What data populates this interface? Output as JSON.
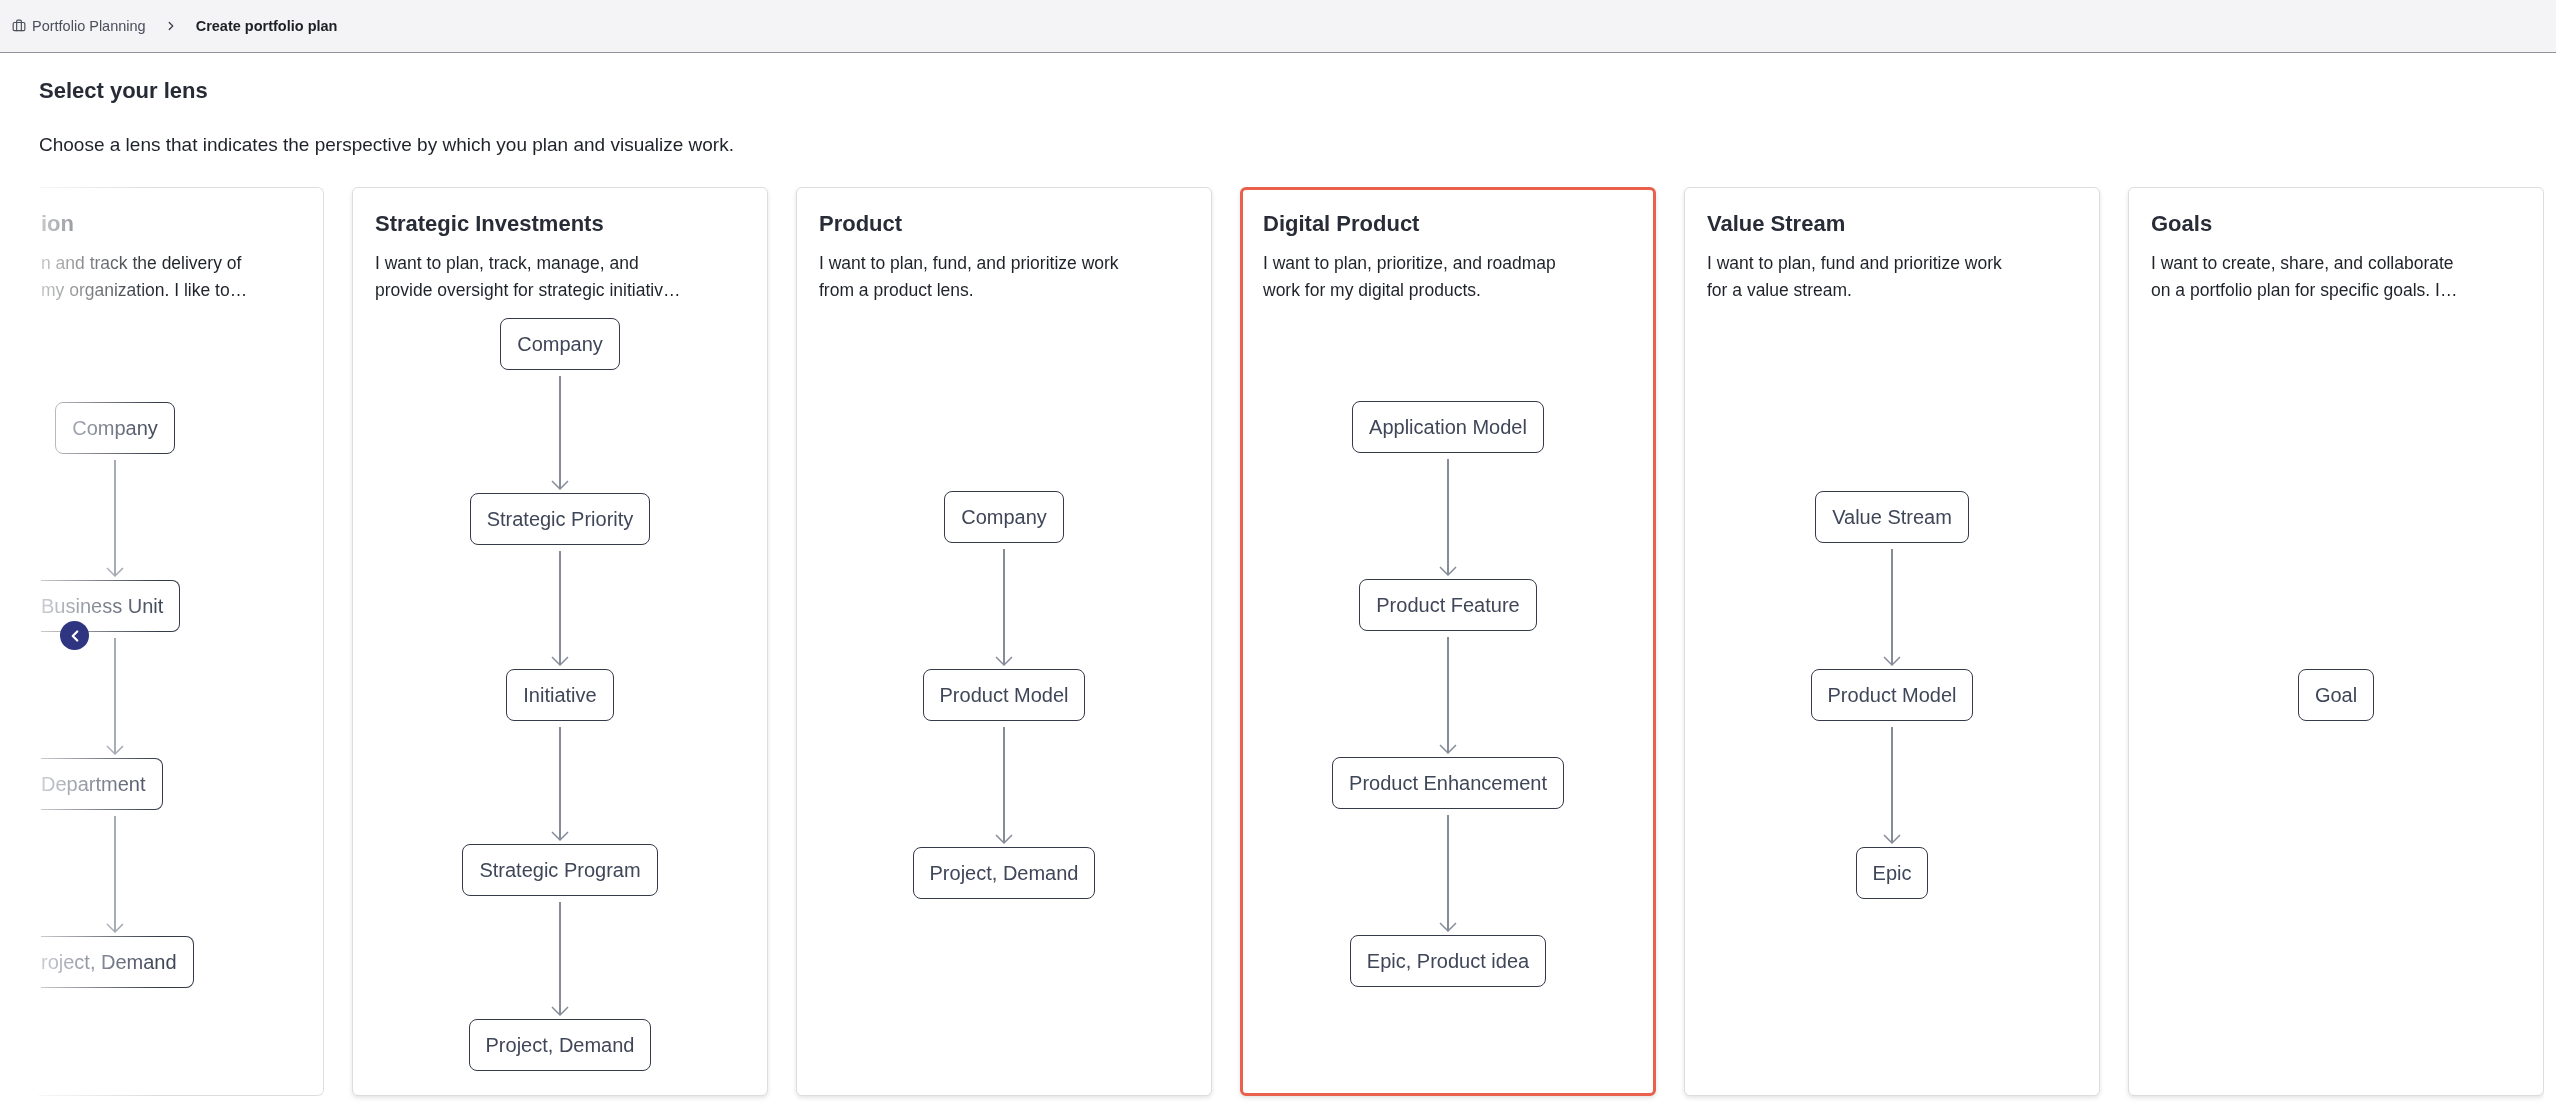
{
  "breadcrumb": [
    {
      "kind": "link",
      "label": "Portfolio Planning"
    },
    {
      "kind": "current",
      "label": "Create portfolio plan"
    }
  ],
  "page": {
    "title": "Select your lens",
    "description": "Choose a lens that indicates the perspective by which you plan and visualize work."
  },
  "lens_cards": [
    {
      "kind": "partial",
      "selected": false,
      "title": "ion",
      "description": [
        "n and track the delivery of",
        "my organization. I like to…"
      ],
      "nodes": [
        {
          "label": "Company",
          "clipped": false
        },
        {
          "label": "Business Unit",
          "clipped": true
        },
        {
          "label": "Department",
          "clipped": true
        },
        {
          "label": "roject, Demand",
          "clipped": true
        }
      ]
    },
    {
      "kind": "full",
      "selected": false,
      "title": "Strategic Investments",
      "description": [
        "I want to plan, track, manage, and",
        "provide oversight for strategic initiativ…"
      ],
      "nodes": [
        {
          "label": "Company",
          "clipped": false
        },
        {
          "label": "Strategic Priority",
          "clipped": false
        },
        {
          "label": "Initiative",
          "clipped": false
        },
        {
          "label": "Strategic Program",
          "clipped": false
        },
        {
          "label": "Project, Demand",
          "clipped": false
        }
      ]
    },
    {
      "kind": "full",
      "selected": false,
      "title": "Product",
      "description": [
        "I want to plan, fund, and prioritize work",
        "from a product lens."
      ],
      "nodes": [
        {
          "label": "Company",
          "clipped": false
        },
        {
          "label": "Product Model",
          "clipped": false
        },
        {
          "label": "Project, Demand",
          "clipped": false
        }
      ]
    },
    {
      "kind": "full",
      "selected": true,
      "title": "Digital Product",
      "description": [
        "I want to plan, prioritize, and roadmap",
        "work for my digital products."
      ],
      "nodes": [
        {
          "label": "Application Model",
          "clipped": false
        },
        {
          "label": "Product Feature",
          "clipped": false
        },
        {
          "label": "Product Enhancement",
          "clipped": false
        },
        {
          "label": "Epic, Product idea",
          "clipped": false
        }
      ]
    },
    {
      "kind": "full",
      "selected": false,
      "title": "Value Stream",
      "description": [
        "I want to plan, fund and prioritize work",
        "for a value stream."
      ],
      "nodes": [
        {
          "label": "Value Stream",
          "clipped": false
        },
        {
          "label": "Product Model",
          "clipped": false
        },
        {
          "label": "Epic",
          "clipped": false
        }
      ]
    },
    {
      "kind": "full",
      "selected": false,
      "title": "Goals",
      "description": [
        "I want to create, share, and collaborate",
        "on a portfolio plan for specific goals. I…"
      ],
      "nodes": [
        {
          "label": "Goal",
          "clipped": false
        }
      ]
    }
  ]
}
